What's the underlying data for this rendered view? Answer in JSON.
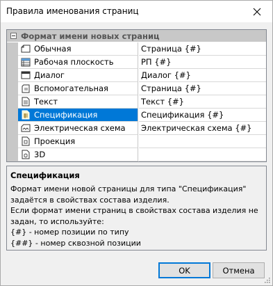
{
  "window": {
    "title": "Правила именования страниц"
  },
  "grid": {
    "category": "Формат имени новых страниц",
    "rows": [
      {
        "name": "Обычная",
        "value": "Страница {#}",
        "icon": "page-icon"
      },
      {
        "name": "Рабочая плоскость",
        "value": "РП {#}",
        "icon": "workplane-icon"
      },
      {
        "name": "Диалог",
        "value": "Диалог {#}",
        "icon": "dialog-icon"
      },
      {
        "name": "Вспомогательная",
        "value": "Страница {#}",
        "icon": "auxiliary-page-icon"
      },
      {
        "name": "Текст",
        "value": "Текст {#}",
        "icon": "text-page-icon"
      },
      {
        "name": "Спецификация",
        "value": "Спецификация {#}",
        "icon": "specification-icon"
      },
      {
        "name": "Электрическая схема",
        "value": "Электрическая схема {#}",
        "icon": "electrical-schematic-icon"
      },
      {
        "name": "Проекция",
        "value": "",
        "icon": "projection-page-icon"
      },
      {
        "name": "3D",
        "value": "",
        "icon": "3d-page-icon"
      }
    ],
    "selected_index": 5
  },
  "description": {
    "title": "Спецификация",
    "lines": [
      "Формат имени новой страницы для типа \"Спецификация\"",
      "задаётся в свойствах состава изделия.",
      "Если формат имени страниц в свойствах состава изделия не",
      "задан, то используйте:",
      "{#} - номер позиции по типу",
      "{##} - номер сквозной позиции"
    ]
  },
  "buttons": {
    "ok": "OK",
    "cancel": "Отмена"
  },
  "colors": {
    "selection": "#0078d7",
    "category_bg": "#c8c8c8",
    "default_button_border": "#0078d7"
  }
}
